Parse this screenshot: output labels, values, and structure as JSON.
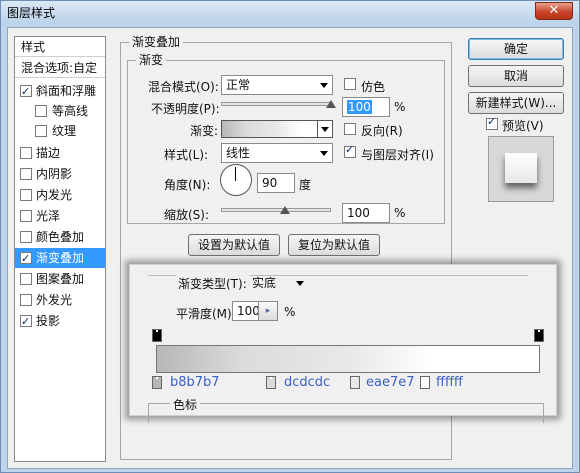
{
  "window": {
    "title": "图层样式",
    "close": "✕"
  },
  "sidebar": {
    "header": "样式",
    "blend_options": "混合选项:自定",
    "items": [
      {
        "label": "斜面和浮雕",
        "checked": true
      },
      {
        "label": "等高线",
        "checked": false
      },
      {
        "label": "纹理",
        "checked": false
      },
      {
        "label": "描边",
        "checked": false
      },
      {
        "label": "内阴影",
        "checked": false
      },
      {
        "label": "内发光",
        "checked": false
      },
      {
        "label": "光泽",
        "checked": false
      },
      {
        "label": "颜色叠加",
        "checked": false
      },
      {
        "label": "渐变叠加",
        "checked": true,
        "selected": true
      },
      {
        "label": "图案叠加",
        "checked": false
      },
      {
        "label": "外发光",
        "checked": false
      },
      {
        "label": "投影",
        "checked": true
      }
    ]
  },
  "overlay": {
    "section_title": "渐变叠加",
    "group_title": "渐变",
    "blend_mode_label": "混合模式(O):",
    "blend_mode_value": "正常",
    "dither_label": "仿色",
    "opacity_label": "不透明度(P):",
    "opacity_value": "100",
    "percent": "%",
    "gradient_label": "渐变:",
    "reverse_label": "反向(R)",
    "style_label": "样式(L):",
    "style_value": "线性",
    "align_label": "与图层对齐(I)",
    "angle_label": "角度(N):",
    "angle_value": "90",
    "degree": "度",
    "scale_label": "缩放(S):",
    "scale_value": "100",
    "opacity_level": 1.0,
    "scale_level": 0.6,
    "set_default": "设置为默认值",
    "reset_default": "复位为默认值"
  },
  "buttons": {
    "ok": "确定",
    "cancel": "取消",
    "new_style": "新建样式(W)...",
    "preview": "预览(V)"
  },
  "gradient_editor": {
    "type_label": "渐变类型(T):",
    "type_value": "实底",
    "smoothness_label": "平滑度(M):",
    "smoothness_value": "100",
    "percent": "%",
    "stops_label": "色标",
    "colors": [
      "b8b7b7",
      "dcdcdc",
      "eae7e7",
      "ffffff"
    ],
    "stop_positions": [
      0,
      0.23,
      0.5,
      0.72
    ]
  }
}
